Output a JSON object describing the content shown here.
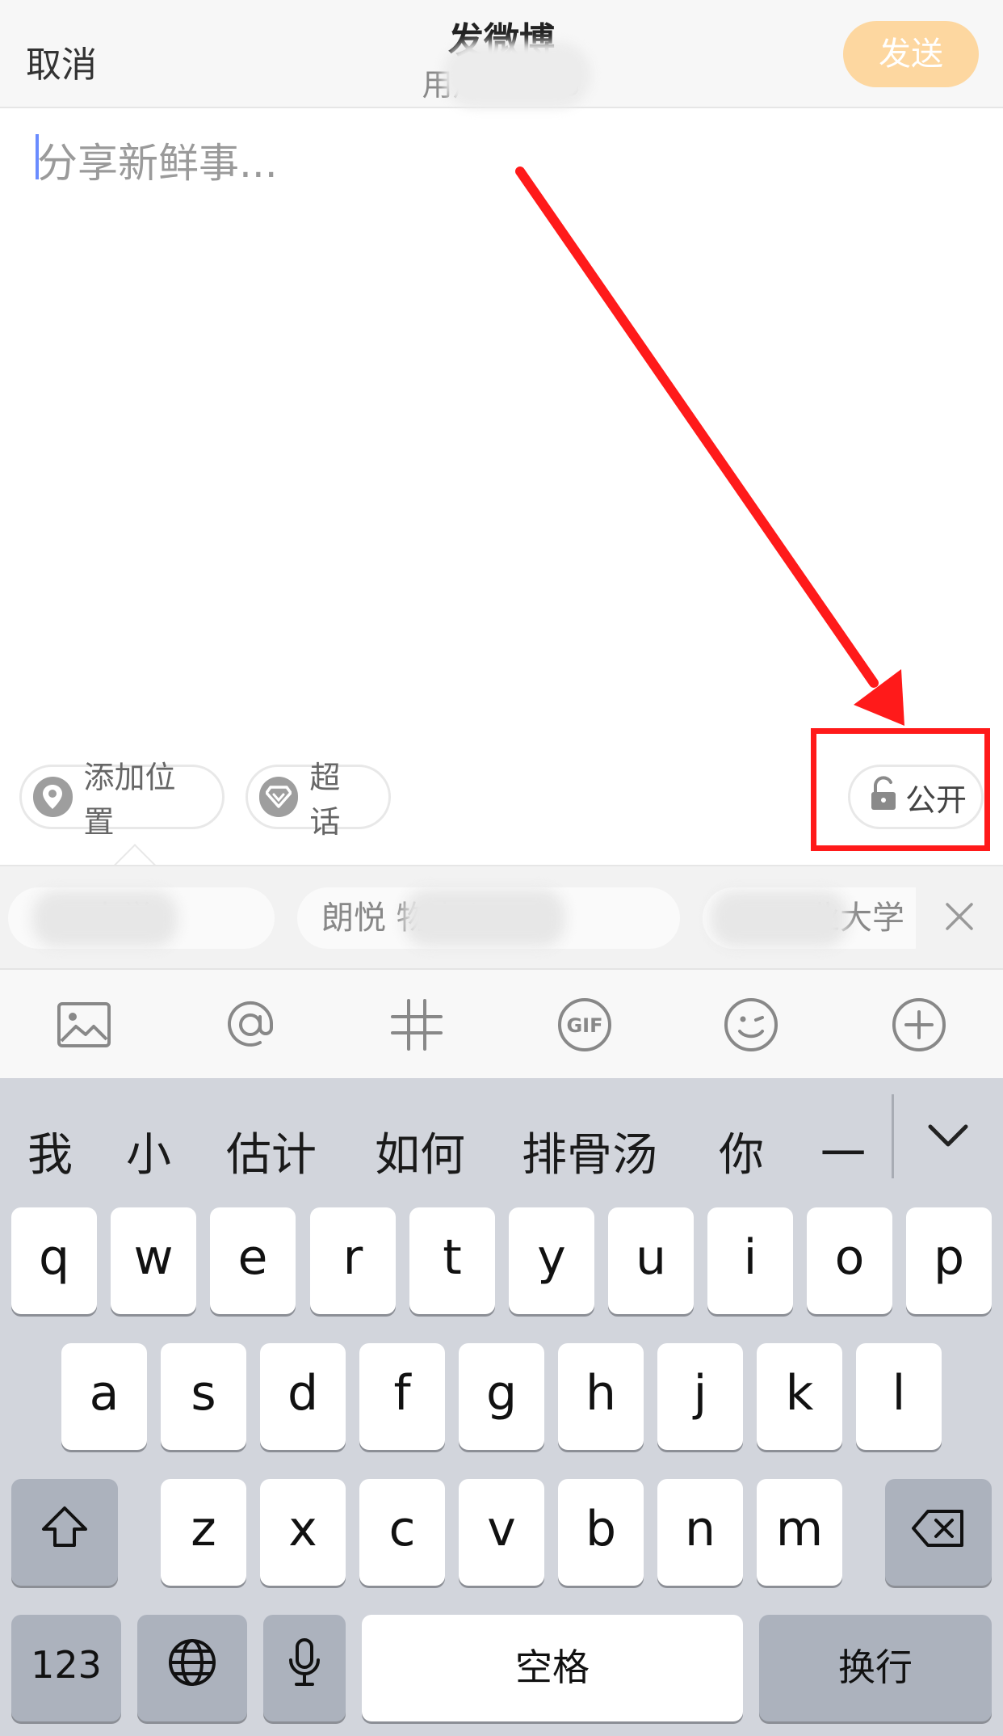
{
  "header": {
    "cancel_label": "取消",
    "title": "发微博",
    "subtitle": "用户 6          365",
    "send_label": "发送"
  },
  "compose": {
    "placeholder": "分享新鲜事..."
  },
  "chips": {
    "location_label": "添加位置",
    "supertopic_label": "超话",
    "visibility_label": "公开"
  },
  "location_suggestions": [
    "   大学",
    "朗悦           物中心",
    "          业大学"
  ],
  "toolbar": {
    "icons": [
      "image-icon",
      "at-icon",
      "hashtag-icon",
      "gif-icon",
      "emoji-icon",
      "add-icon"
    ],
    "gif_text": "GIF"
  },
  "keyboard": {
    "candidates": [
      "我",
      "小",
      "估计",
      "如何",
      "排骨汤",
      "你",
      "一"
    ],
    "row1": [
      "q",
      "w",
      "e",
      "r",
      "t",
      "y",
      "u",
      "i",
      "o",
      "p"
    ],
    "row2": [
      "a",
      "s",
      "d",
      "f",
      "g",
      "h",
      "j",
      "k",
      "l"
    ],
    "row3": [
      "z",
      "x",
      "c",
      "v",
      "b",
      "n",
      "m"
    ],
    "numbers_label": "123",
    "space_label": "空格",
    "return_label": "换行"
  },
  "colors": {
    "send_button": "#fdd7a0",
    "annotation": "#ff1a1a",
    "keyboard_bg": "#d2d5dc"
  }
}
